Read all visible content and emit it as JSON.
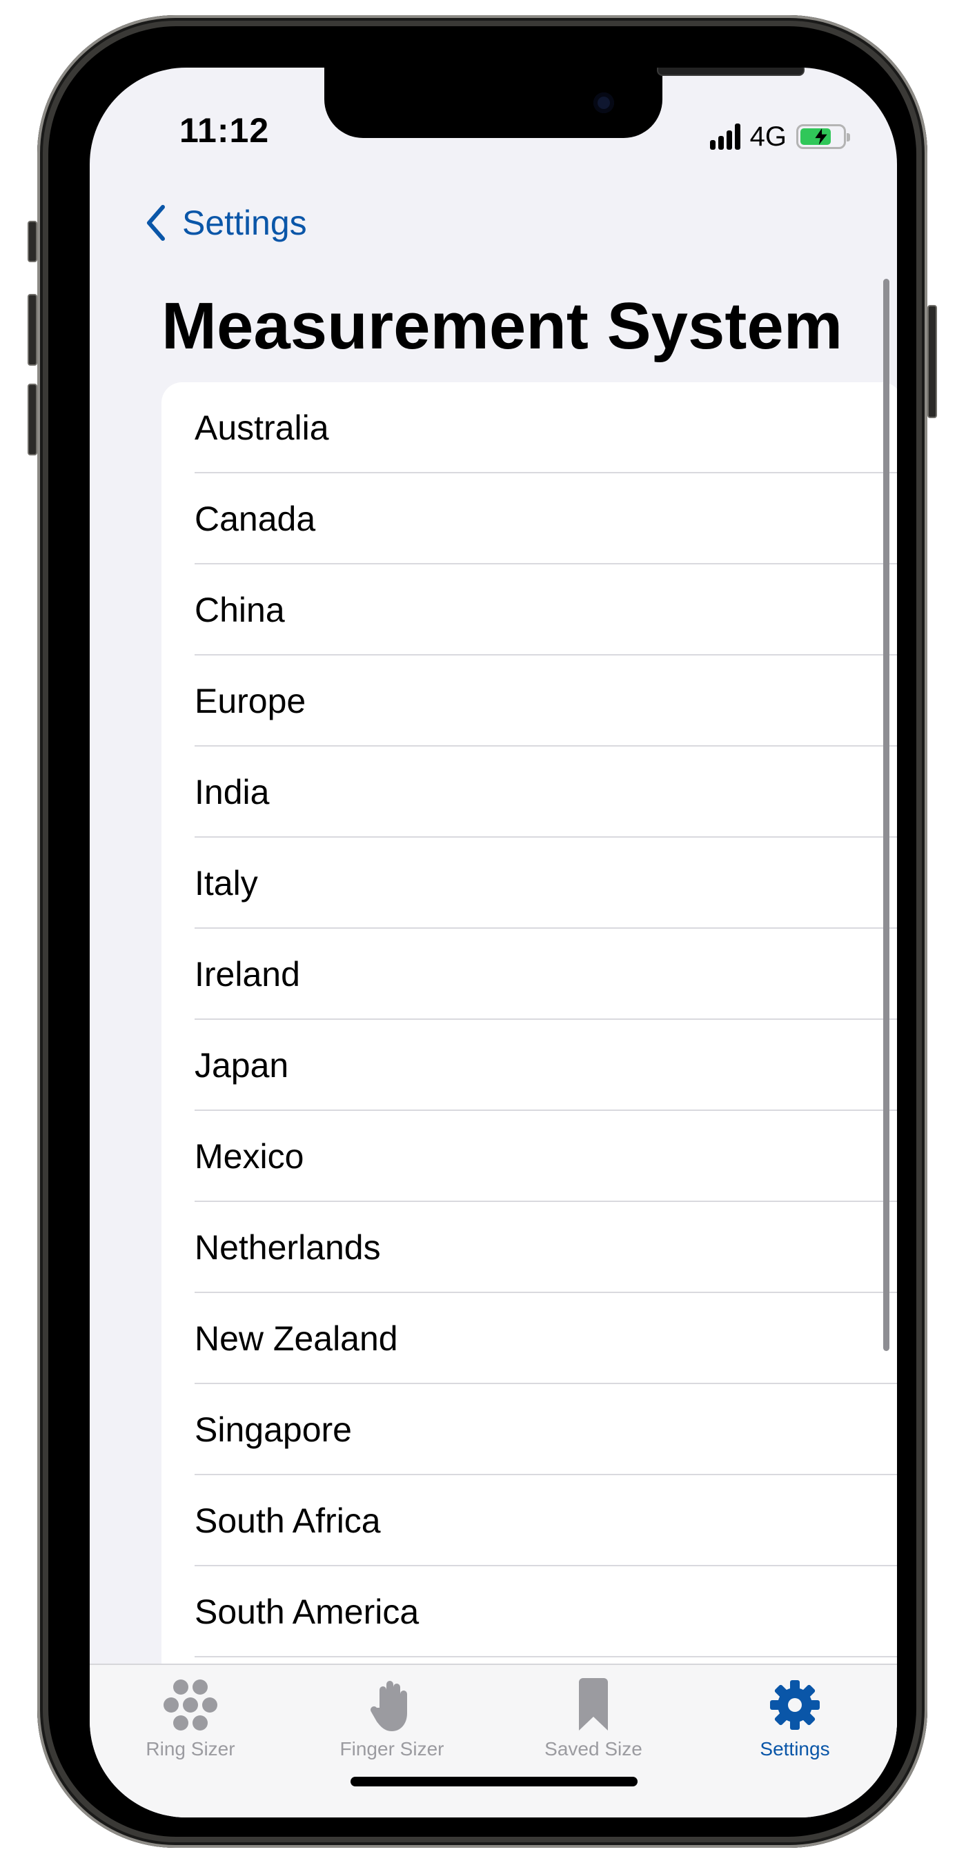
{
  "status_bar": {
    "time": "11:12",
    "network": "4G",
    "battery_color": "#30c759"
  },
  "nav": {
    "back_label": "Settings",
    "back_icon": "chevron-left-icon"
  },
  "page": {
    "title": "Measurement System"
  },
  "list": {
    "items": [
      {
        "label": "Australia"
      },
      {
        "label": "Canada"
      },
      {
        "label": "China"
      },
      {
        "label": "Europe"
      },
      {
        "label": "India"
      },
      {
        "label": "Italy"
      },
      {
        "label": "Ireland"
      },
      {
        "label": "Japan"
      },
      {
        "label": "Mexico"
      },
      {
        "label": "Netherlands"
      },
      {
        "label": "New Zealand"
      },
      {
        "label": "Singapore"
      },
      {
        "label": "South Africa"
      },
      {
        "label": "South America"
      }
    ]
  },
  "tabbar": {
    "tabs": [
      {
        "label": "Ring Sizer",
        "icon": "ring-circles-icon",
        "active": false
      },
      {
        "label": "Finger Sizer",
        "icon": "hand-icon",
        "active": false
      },
      {
        "label": "Saved Size",
        "icon": "bookmark-icon",
        "active": false
      },
      {
        "label": "Settings",
        "icon": "gear-icon",
        "active": true
      }
    ]
  },
  "colors": {
    "accent": "#0a56a8",
    "inactive": "#9b9ba0",
    "background": "#f2f2f7"
  }
}
